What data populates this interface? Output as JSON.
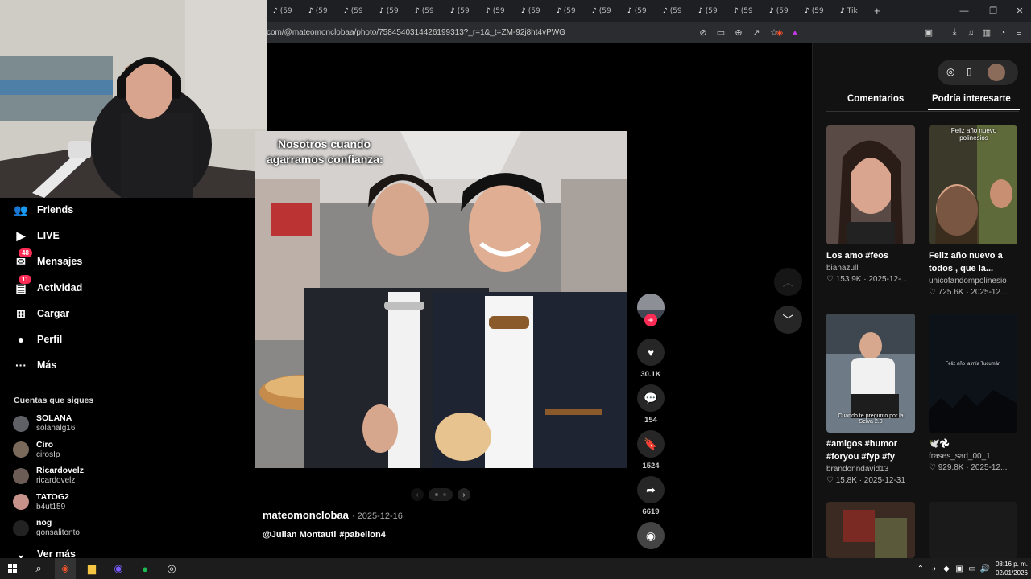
{
  "browser": {
    "tabs": [
      {
        "icon": "tiktok-icon",
        "label": "(59"
      },
      {
        "icon": "tiktok-icon",
        "label": "(59"
      },
      {
        "icon": "tiktok-icon",
        "label": "(59"
      },
      {
        "icon": "tiktok-icon",
        "label": "(59"
      },
      {
        "icon": "tiktok-icon",
        "label": "(59"
      },
      {
        "icon": "tiktok-icon",
        "label": "(59"
      },
      {
        "icon": "tiktok-icon",
        "label": "(59"
      },
      {
        "icon": "tiktok-icon",
        "label": "(59"
      },
      {
        "icon": "tiktok-icon",
        "label": "(59"
      },
      {
        "icon": "tiktok-icon",
        "label": "(59"
      },
      {
        "icon": "tiktok-icon",
        "label": "(59"
      },
      {
        "icon": "tiktok-icon",
        "label": "(59"
      },
      {
        "icon": "tiktok-icon",
        "label": "(59"
      },
      {
        "icon": "tiktok-icon",
        "label": "(59"
      },
      {
        "icon": "tiktok-icon",
        "label": "(59"
      },
      {
        "icon": "tiktok-icon",
        "label": "(59"
      },
      {
        "icon": "tiktok-icon",
        "label": "Tik"
      }
    ],
    "new_tab": "+",
    "url": "com/@mateomonclobaa/photo/7584540314426199313?_r=1&_t=ZM-92j8ht4vPWG"
  },
  "sidebar": {
    "nav": [
      {
        "icon": "friends-icon",
        "label": "Friends"
      },
      {
        "icon": "live-icon",
        "label": "LIVE"
      },
      {
        "icon": "messages-icon",
        "label": "Mensajes",
        "badge": "48"
      },
      {
        "icon": "activity-icon",
        "label": "Actividad",
        "badge": "11"
      },
      {
        "icon": "upload-icon",
        "label": "Cargar"
      },
      {
        "icon": "profile-icon",
        "label": "Perfil"
      },
      {
        "icon": "more-icon",
        "label": "Más"
      }
    ],
    "following_title": "Cuentas que sigues",
    "following": [
      {
        "name": "SOLANA",
        "user": "solanalg16"
      },
      {
        "name": "Ciro",
        "user": "cirosIp"
      },
      {
        "name": "Ricardovelz",
        "user": "ricardovelz"
      },
      {
        "name": "TATOG2",
        "user": "b4ut159"
      },
      {
        "name": "nog",
        "user": "gonsalitonto"
      }
    ],
    "see_more": "Ver más"
  },
  "post": {
    "overlay_text_1": "Nosotros cuando",
    "overlay_text_2": "agarramos confianza:",
    "author": "mateomonclobaa",
    "date": "· 2025-12-16",
    "caption_mention": "@Julian Montauti",
    "caption_tag": "#pabellon4",
    "likes": "30.1K",
    "comments": "154",
    "saves": "1524",
    "shares": "6619"
  },
  "right": {
    "tab_comments": "Comentarios",
    "tab_suggest": "Podría interesarte",
    "cards": [
      {
        "title": "Los amo #feos",
        "user": "bianazull",
        "likes": "♡ 153.9K",
        "date": "2025-12-..."
      },
      {
        "title": "Feliz año nuevo a todos , que la...",
        "user": "unicofandompolinesio",
        "likes": "♡ 725.6K",
        "date": "2025-12..."
      },
      {
        "title": "#amigos #humor #foryou #fyp #fy",
        "user": "brandonndavid13",
        "likes": "♡ 15.8K",
        "date": "2025-12-31"
      },
      {
        "title": "🕊️𖣘",
        "user": "frases_sad_00_1",
        "likes": "♡ 929.8K",
        "date": "2025-12..."
      }
    ],
    "thumb_text_2": "Feliz año nuevo polinesios",
    "thumb_text_3": "Cuando te pregunto por la Selva 2.0",
    "thumb_text_4": "Feliz año la mía Tucumán"
  },
  "taskbar": {
    "time": "08:16 p. m.",
    "date": "02/01/2026"
  }
}
